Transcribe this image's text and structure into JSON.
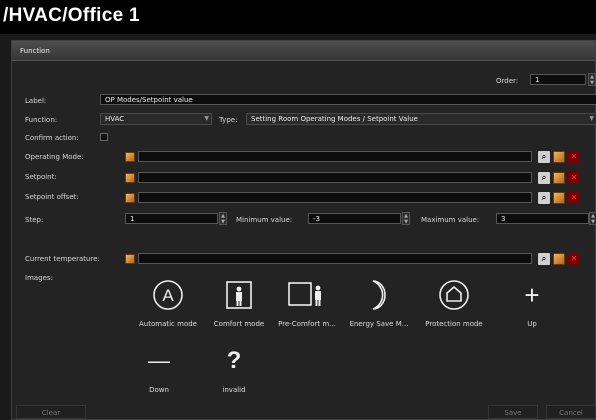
{
  "title": "/HVAC/Office 1",
  "panel_header": "Function",
  "order": {
    "label": "Order:",
    "value": "1"
  },
  "form": {
    "label_label": "Label:",
    "label_value": "OP Modes/Setpoint value",
    "function_label": "Function:",
    "function_value": "HVAC",
    "type_label": "Type:",
    "type_value": "Setting Room Operating Modes / Setpoint Value",
    "confirm_label": "Confirm action:",
    "operating_mode_label": "Operating Mode:",
    "setpoint_label": "Setpoint:",
    "setpoint_offset_label": "Setpoint offset:",
    "step_label": "Step:",
    "step_value": "1",
    "min_label": "Minimum value:",
    "min_value": "-3",
    "max_label": "Maximum value:",
    "max_value": "3",
    "current_temp_label": "Current temperature:",
    "images_label": "Images:"
  },
  "images": [
    {
      "label": "Automatic mode",
      "icon": "letter-a-circle-icon",
      "glyph": "A"
    },
    {
      "label": "Comfort mode",
      "icon": "person-door-icon"
    },
    {
      "label": "Pre-Comfort m...",
      "icon": "person-box-icon"
    },
    {
      "label": "Energy Save M...",
      "icon": "moon-icon"
    },
    {
      "label": "Protection mode",
      "icon": "house-circle-icon"
    },
    {
      "label": "Up",
      "icon": "plus-icon",
      "glyph": "+"
    },
    {
      "label": "Down",
      "icon": "minus-icon",
      "glyph": "—"
    },
    {
      "label": "invalid",
      "icon": "question-icon",
      "glyph": "?"
    }
  ],
  "buttons": {
    "clear": "Clear",
    "save": "Save",
    "cancel": "Cancel"
  },
  "colors": {
    "accent": "#e07a1a",
    "delete": "#7a0000"
  }
}
